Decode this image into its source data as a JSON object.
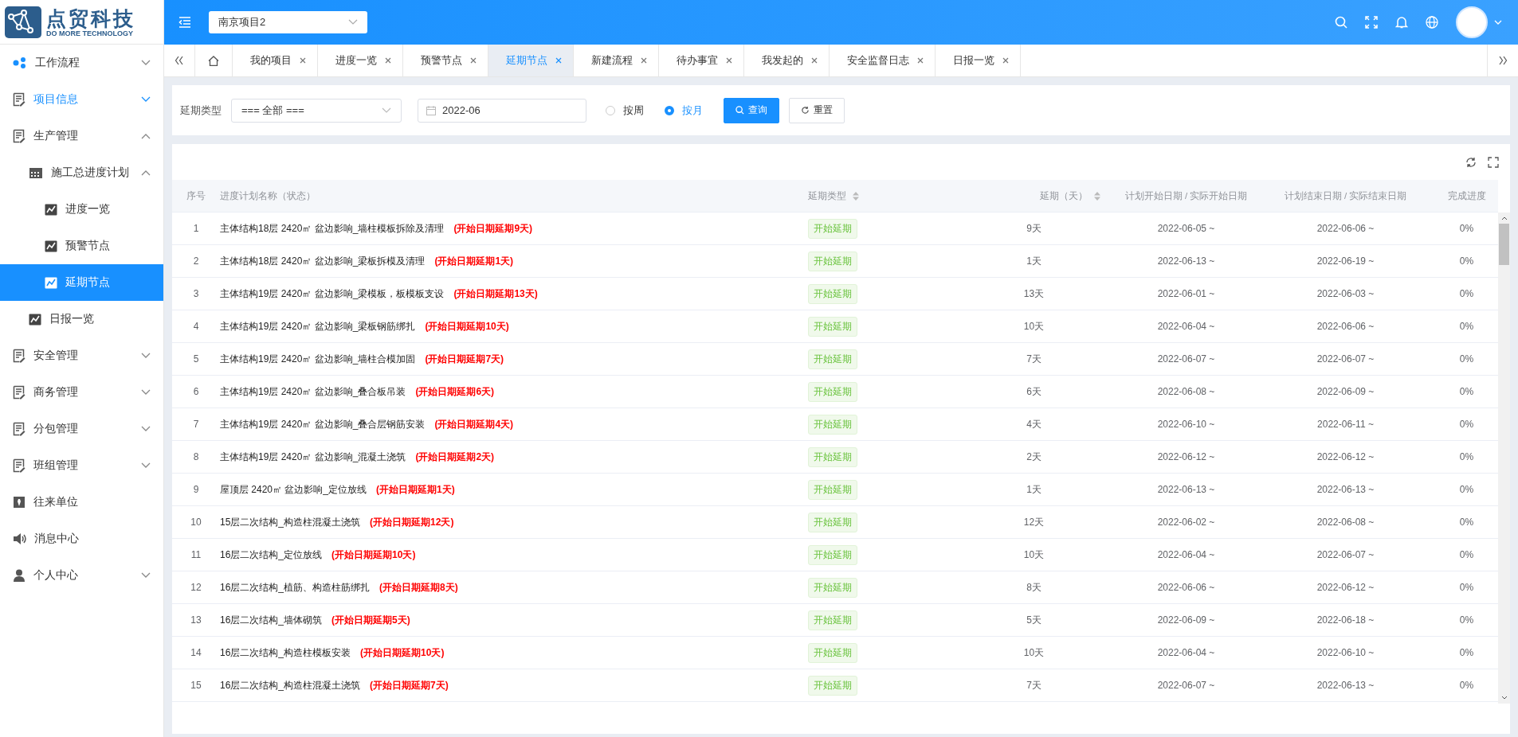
{
  "logo": {
    "title": "点贸科技",
    "subtitle": "DO MORE TECHNOLOGY"
  },
  "header": {
    "project": "南京项目2"
  },
  "sidebar": {
    "items": [
      {
        "label": "工作流程",
        "kind": "share",
        "expanded": false,
        "highlighted": false,
        "selected": false
      },
      {
        "label": "项目信息",
        "kind": "doc",
        "expanded": false,
        "highlighted": true,
        "selected": false
      },
      {
        "label": "生产管理",
        "kind": "doc",
        "expanded": true,
        "highlighted": false,
        "selected": false,
        "children": [
          {
            "label": "施工总进度计划",
            "kind": "calendar",
            "expanded": true,
            "highlighted": false,
            "selected": false,
            "children": [
              {
                "label": "进度一览",
                "kind": "chart",
                "highlighted": false,
                "selected": false
              },
              {
                "label": "预警节点",
                "kind": "chart",
                "highlighted": false,
                "selected": false
              },
              {
                "label": "延期节点",
                "kind": "chart",
                "highlighted": false,
                "selected": true
              }
            ]
          },
          {
            "label": "日报一览",
            "kind": "chart",
            "highlighted": false,
            "selected": false
          }
        ]
      },
      {
        "label": "安全管理",
        "kind": "doc",
        "expanded": false,
        "highlighted": false,
        "selected": false
      },
      {
        "label": "商务管理",
        "kind": "doc",
        "expanded": false,
        "highlighted": false,
        "selected": false
      },
      {
        "label": "分包管理",
        "kind": "doc",
        "expanded": false,
        "highlighted": false,
        "selected": false
      },
      {
        "label": "班组管理",
        "kind": "doc",
        "expanded": false,
        "highlighted": false,
        "selected": false
      },
      {
        "label": "往来单位",
        "kind": "badge",
        "highlighted": false,
        "selected": false
      },
      {
        "label": "消息中心",
        "kind": "speaker",
        "highlighted": false,
        "selected": false
      },
      {
        "label": "个人中心",
        "kind": "person",
        "expanded": false,
        "highlighted": false,
        "selected": false
      }
    ]
  },
  "tabs": [
    {
      "label": "我的项目",
      "selected": false
    },
    {
      "label": "进度一览",
      "selected": false
    },
    {
      "label": "预警节点",
      "selected": false
    },
    {
      "label": "延期节点",
      "selected": true
    },
    {
      "label": "新建流程",
      "selected": false
    },
    {
      "label": "待办事宜",
      "selected": false
    },
    {
      "label": "我发起的",
      "selected": false
    },
    {
      "label": "安全监督日志",
      "selected": false
    },
    {
      "label": "日报一览",
      "selected": false
    }
  ],
  "filter": {
    "label": "延期类型",
    "type_value": "=== 全部 ===",
    "month_value": "2022-06",
    "radios": [
      {
        "label": "按周",
        "selected": false
      },
      {
        "label": "按月",
        "selected": true
      }
    ],
    "buttons": [
      {
        "label": "查询",
        "kind": "primary"
      },
      {
        "label": "重置",
        "kind": "reset"
      }
    ]
  },
  "table": {
    "columns": [
      {
        "label": "序号",
        "sortable": false
      },
      {
        "label": "进度计划名称（状态）",
        "sortable": false
      },
      {
        "label": "延期类型",
        "sortable": true
      },
      {
        "label": "延期（天）",
        "sortable": true
      },
      {
        "label": "计划开始日期 / 实际开始日期",
        "sortable": false
      },
      {
        "label": "计划结束日期 / 实际结束日期",
        "sortable": false
      },
      {
        "label": "完成进度",
        "sortable": false
      }
    ],
    "rows": [
      {
        "index": "1",
        "name": "主体结构18层 2420㎡ 盆边影响_墙柱模板拆除及清理",
        "status": "(开始日期延期9天)",
        "type": "开始延期",
        "days": "9天",
        "start": "2022-06-05 ~",
        "end": "2022-06-06 ~",
        "progress": "0%"
      },
      {
        "index": "2",
        "name": "主体结构18层 2420㎡ 盆边影响_梁板拆模及清理",
        "status": "(开始日期延期1天)",
        "type": "开始延期",
        "days": "1天",
        "start": "2022-06-13 ~",
        "end": "2022-06-19 ~",
        "progress": "0%"
      },
      {
        "index": "3",
        "name": "主体结构19层 2420㎡ 盆边影响_梁模板，板模板支设",
        "status": "(开始日期延期13天)",
        "type": "开始延期",
        "days": "13天",
        "start": "2022-06-01 ~",
        "end": "2022-06-03 ~",
        "progress": "0%"
      },
      {
        "index": "4",
        "name": "主体结构19层 2420㎡ 盆边影响_梁板钢筋绑扎",
        "status": "(开始日期延期10天)",
        "type": "开始延期",
        "days": "10天",
        "start": "2022-06-04 ~",
        "end": "2022-06-06 ~",
        "progress": "0%"
      },
      {
        "index": "5",
        "name": "主体结构19层 2420㎡ 盆边影响_墙柱合模加固",
        "status": "(开始日期延期7天)",
        "type": "开始延期",
        "days": "7天",
        "start": "2022-06-07 ~",
        "end": "2022-06-07 ~",
        "progress": "0%"
      },
      {
        "index": "6",
        "name": "主体结构19层 2420㎡ 盆边影响_叠合板吊装",
        "status": "(开始日期延期6天)",
        "type": "开始延期",
        "days": "6天",
        "start": "2022-06-08 ~",
        "end": "2022-06-09 ~",
        "progress": "0%"
      },
      {
        "index": "7",
        "name": "主体结构19层 2420㎡ 盆边影响_叠合层钢筋安装",
        "status": "(开始日期延期4天)",
        "type": "开始延期",
        "days": "4天",
        "start": "2022-06-10 ~",
        "end": "2022-06-11 ~",
        "progress": "0%"
      },
      {
        "index": "8",
        "name": "主体结构19层 2420㎡ 盆边影响_混凝土浇筑",
        "status": "(开始日期延期2天)",
        "type": "开始延期",
        "days": "2天",
        "start": "2022-06-12 ~",
        "end": "2022-06-12 ~",
        "progress": "0%"
      },
      {
        "index": "9",
        "name": "屋顶层 2420㎡ 盆边影响_定位放线",
        "status": "(开始日期延期1天)",
        "type": "开始延期",
        "days": "1天",
        "start": "2022-06-13 ~",
        "end": "2022-06-13 ~",
        "progress": "0%"
      },
      {
        "index": "10",
        "name": "15层二次结构_构造柱混凝土浇筑",
        "status": "(开始日期延期12天)",
        "type": "开始延期",
        "days": "12天",
        "start": "2022-06-02 ~",
        "end": "2022-06-08 ~",
        "progress": "0%"
      },
      {
        "index": "11",
        "name": "16层二次结构_定位放线",
        "status": "(开始日期延期10天)",
        "type": "开始延期",
        "days": "10天",
        "start": "2022-06-04 ~",
        "end": "2022-06-07 ~",
        "progress": "0%"
      },
      {
        "index": "12",
        "name": "16层二次结构_植筋、构造柱筋绑扎",
        "status": "(开始日期延期8天)",
        "type": "开始延期",
        "days": "8天",
        "start": "2022-06-06 ~",
        "end": "2022-06-12 ~",
        "progress": "0%"
      },
      {
        "index": "13",
        "name": "16层二次结构_墙体砌筑",
        "status": "(开始日期延期5天)",
        "type": "开始延期",
        "days": "5天",
        "start": "2022-06-09 ~",
        "end": "2022-06-18 ~",
        "progress": "0%"
      },
      {
        "index": "14",
        "name": "16层二次结构_构造柱模板安装",
        "status": "(开始日期延期10天)",
        "type": "开始延期",
        "days": "10天",
        "start": "2022-06-04 ~",
        "end": "2022-06-10 ~",
        "progress": "0%"
      },
      {
        "index": "15",
        "name": "16层二次结构_构造柱混凝土浇筑",
        "status": "(开始日期延期7天)",
        "type": "开始延期",
        "days": "7天",
        "start": "2022-06-07 ~",
        "end": "2022-06-13 ~",
        "progress": "0%"
      }
    ]
  }
}
